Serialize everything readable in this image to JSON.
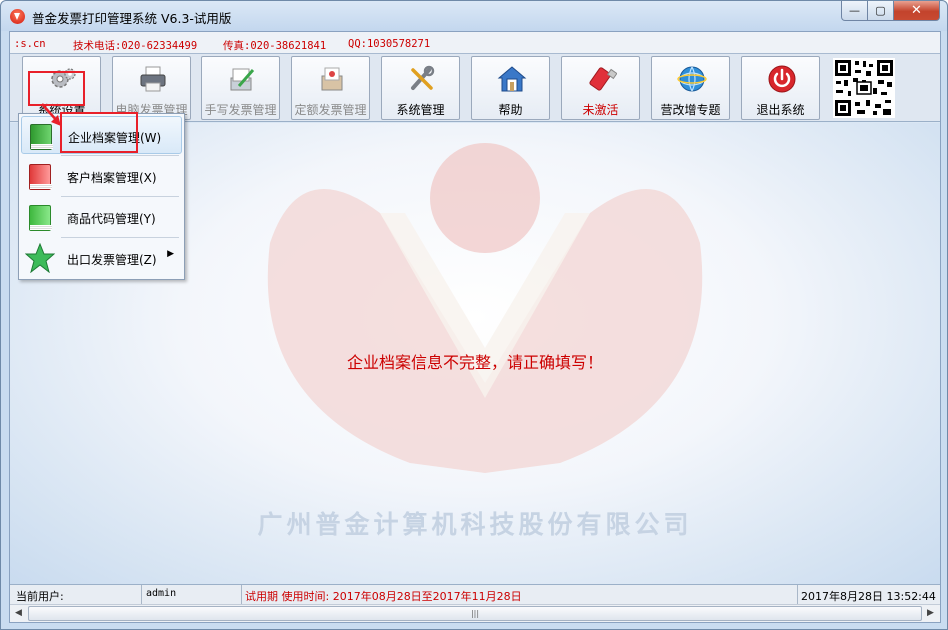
{
  "window": {
    "title": "普金发票打印管理系统 V6.3-试用版",
    "controls": {
      "minimize": "—",
      "maximize": "▢",
      "close": "✕"
    }
  },
  "infobar": {
    "site": ":s.cn",
    "support_phone": "技术电话:020-62334499",
    "fax": "传真:020-38621841",
    "qq": "QQ:1030578271"
  },
  "toolbar": {
    "buttons": [
      {
        "label": "系统设置",
        "icon": "gears-icon",
        "state": "active"
      },
      {
        "label": "电脑发票管理",
        "icon": "printer-icon",
        "state": "disabled"
      },
      {
        "label": "手写发票管理",
        "icon": "handwriting-icon",
        "state": "disabled"
      },
      {
        "label": "定额发票管理",
        "icon": "fixed-invoice-icon",
        "state": "disabled"
      },
      {
        "label": "系统管理",
        "icon": "tools-icon",
        "state": "normal"
      },
      {
        "label": "帮助",
        "icon": "home-icon",
        "state": "normal"
      },
      {
        "label": "未激活",
        "icon": "usb-key-icon",
        "state": "warning"
      },
      {
        "label": "营改增专题",
        "icon": "globe-icon",
        "state": "normal"
      },
      {
        "label": "退出系统",
        "icon": "power-icon",
        "state": "normal"
      }
    ],
    "qr_code_icon": "qr-code-icon"
  },
  "menu": {
    "items": [
      {
        "label": "企业档案管理(W)",
        "icon": "green-book-icon",
        "highlighted": true,
        "submenu": false
      },
      {
        "label": "客户档案管理(X)",
        "icon": "red-book-icon",
        "highlighted": false,
        "submenu": false
      },
      {
        "label": "商品代码管理(Y)",
        "icon": "green-book-icon",
        "highlighted": false,
        "submenu": false
      },
      {
        "label": "出口发票管理(Z)",
        "icon": "star-icon",
        "highlighted": false,
        "submenu": true
      }
    ]
  },
  "main": {
    "message": "企业档案信息不完整，请正确填写！",
    "company_watermark": "广州普金计算机科技股份有限公司"
  },
  "statusbar": {
    "current_user_label": "当前用户:",
    "current_user": "admin",
    "trial_info": "试用期 使用时间: 2017年08月28日至2017年11月28日",
    "datetime": "2017年8月28日 13:52:44"
  },
  "colors": {
    "accent_red": "#cc0000",
    "annotation_red": "#e8202a",
    "window_blue": "#c9dcf0"
  }
}
